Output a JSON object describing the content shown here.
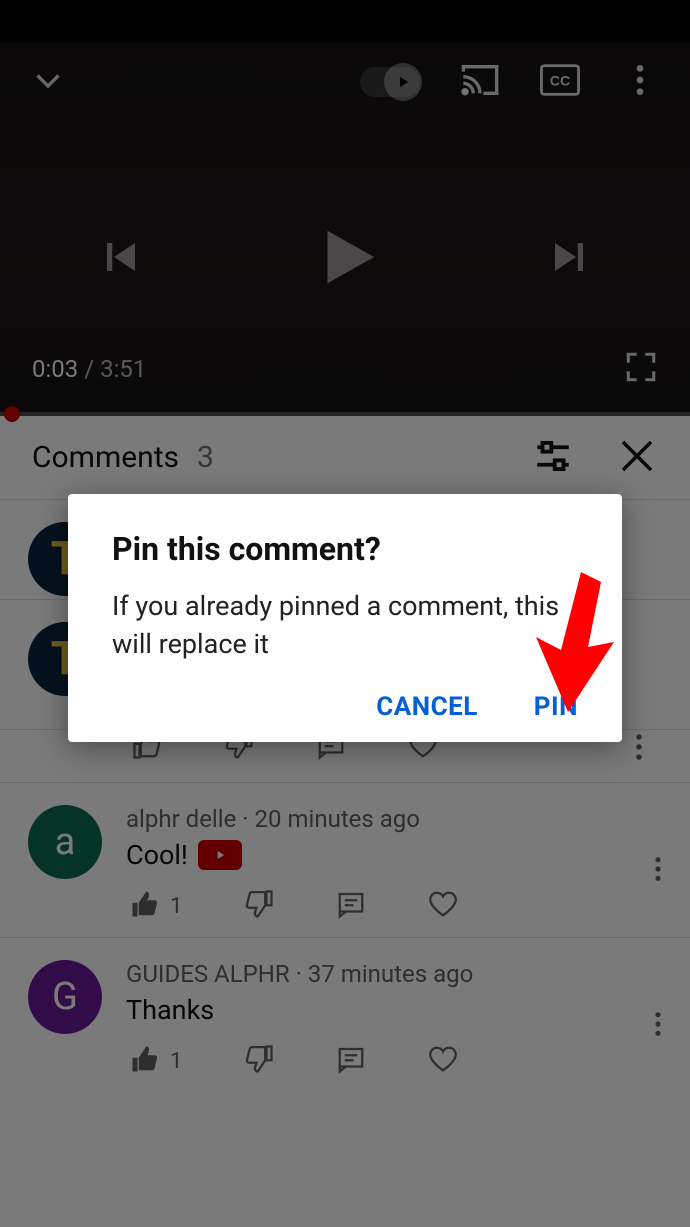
{
  "video": {
    "time_current": "0:03",
    "time_total": "3:51"
  },
  "comments_header": {
    "title": "Comments",
    "count": "3"
  },
  "dialog": {
    "title": "Pin this comment?",
    "body": "If you already pinned a comment, this will replace it",
    "cancel_label": "CANCEL",
    "pin_label": "PIN"
  },
  "comments": [
    {
      "avatar_letter": "T",
      "author": "",
      "time": "",
      "text": ""
    },
    {
      "avatar_letter": "T",
      "author": "",
      "time": "",
      "text": ""
    },
    {
      "avatar_letter": "a",
      "author": "alphr delle",
      "time": "20 minutes ago",
      "text": "Cool!",
      "likes": "1"
    },
    {
      "avatar_letter": "G",
      "author": "GUIDES ALPHR",
      "time": "37 minutes ago",
      "text": "Thanks",
      "likes": "1"
    }
  ]
}
